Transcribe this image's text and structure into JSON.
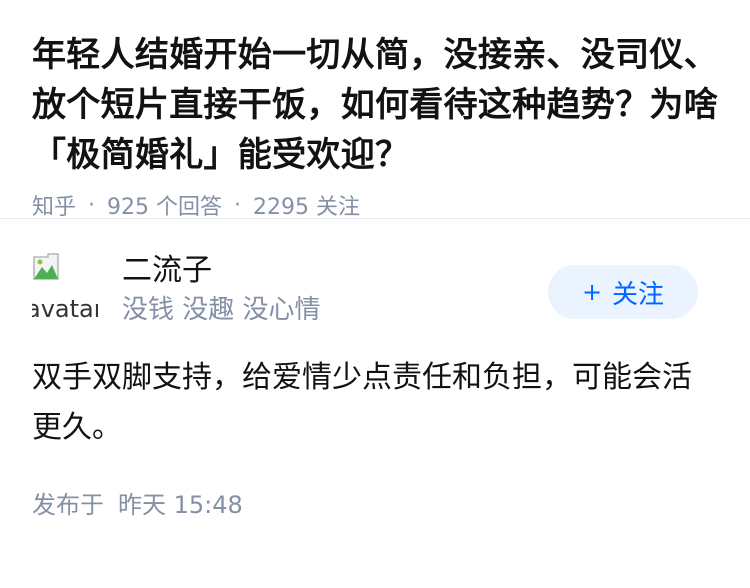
{
  "question": {
    "title": "年轻人结婚开始一切从简，没接亲、没司仪、放个短片直接干饭，如何看待这种趋势？为啥「极简婚礼」能受欢迎？",
    "source": "知乎",
    "answers_count": "925 个回答",
    "followers_count": "2295 关注",
    "separator": "·"
  },
  "answer": {
    "author": {
      "avatar_alt": "avatar",
      "name": "二流子",
      "bio": "没钱 没趣 没心情"
    },
    "follow_button": {
      "icon": "+",
      "label": "关注"
    },
    "content": "双手双脚支持，给爱情少点责任和负担，可能会活更久。",
    "published_label": "发布于",
    "published_time": "昨天 15:48"
  },
  "colors": {
    "meta_gray": "#8590a6",
    "accent_blue": "#0066ff",
    "follow_bg": "#eaf3fe"
  }
}
